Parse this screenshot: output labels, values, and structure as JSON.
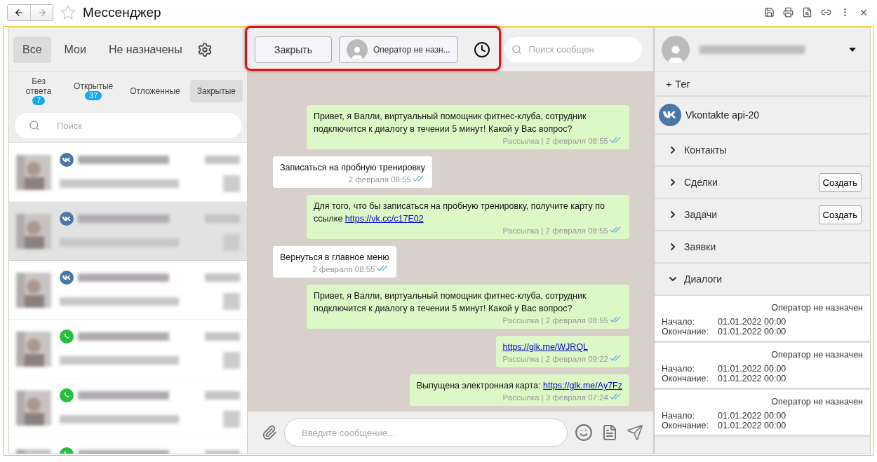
{
  "window": {
    "title": "Мессенджер",
    "starred": false
  },
  "top_tabs": [
    {
      "label": "Все",
      "selected": true
    },
    {
      "label": "Мои",
      "selected": false
    },
    {
      "label": "Не назначены",
      "selected": false
    }
  ],
  "filters": [
    {
      "label": "Без ответа",
      "badge": "7",
      "selected": false
    },
    {
      "label": "Открытые",
      "badge": "37",
      "selected": false
    },
    {
      "label": "Отложенные",
      "selected": false
    },
    {
      "label": "Закрытые",
      "selected": true
    }
  ],
  "contact_search": {
    "placeholder": "Поиск"
  },
  "contacts": [
    {
      "kind": "vk",
      "selected": false
    },
    {
      "kind": "vk",
      "selected": true
    },
    {
      "kind": "vk",
      "selected": false
    },
    {
      "kind": "whatsapp",
      "selected": false
    },
    {
      "kind": "whatsapp",
      "selected": false
    },
    {
      "kind": "whatsapp",
      "selected": false
    }
  ],
  "chat_header": {
    "close_button": "Закрыть",
    "operator_button": "Оператор не назн...",
    "search": {
      "placeholder": "Поиск сообщен"
    }
  },
  "messages": [
    {
      "kind": "out",
      "text": "Привет, я Валли, виртуальный помощник фитнес-клуба, сотрудник подключится к диалогу в течении 5 минут! Какой у Вас вопрос?",
      "meta": "Рассылка | 2 февраля 08:55",
      "read": true
    },
    {
      "kind": "in",
      "text": "Записаться на пробную тренировку",
      "meta": "2 февраля 08:55",
      "read": true
    },
    {
      "kind": "out",
      "text": "Для того, что бы записаться на пробную тренировку, получите карту по ссылке ",
      "link": "https://vk.cc/c17E02",
      "meta": "Рассылка | 2 февраля 08:55",
      "read": true
    },
    {
      "kind": "in",
      "text": "Вернуться в главное меню",
      "meta": "2 февраля 08:55",
      "read": true
    },
    {
      "kind": "out",
      "text": "Привет, я Валли, виртуальный помощник фитнес-клуба, сотрудник подключится к диалогу в течении 5 минут! Какой у Вас вопрос?",
      "meta": "Рассылка | 2 февраля 08:55",
      "read": true
    },
    {
      "kind": "out",
      "link": "https://glk.me/WJRQL",
      "meta": "Рассылка | 2 февраля 09:22",
      "read": true
    },
    {
      "kind": "out",
      "text": "Выпущена электронная карта: ",
      "link": "https://glk.me/Ay7Fz",
      "meta": "Рассылка | 3 февраля 07:24",
      "read": true
    }
  ],
  "composer": {
    "placeholder": "Введите сообщение..."
  },
  "details": {
    "tag_button": "+ Тег",
    "channel": "Vkontakte api-20",
    "sections": [
      {
        "label": "Контакты",
        "expanded": false
      },
      {
        "label": "Сделки",
        "expanded": false,
        "action": "Создать"
      },
      {
        "label": "Задачи",
        "expanded": false,
        "action": "Создать"
      },
      {
        "label": "Заявки",
        "expanded": false
      },
      {
        "label": "Диалоги",
        "expanded": true
      }
    ],
    "dialogs": [
      {
        "operator": "Оператор не назначен",
        "start_label": "Начало:",
        "start": "01.01.2022 00:00",
        "end_label": "Окончание:",
        "end": "01.01.2022 00:00"
      },
      {
        "operator": "Оператор не назначен",
        "start_label": "Начало:",
        "start": "01.01.2022 00:00",
        "end_label": "Окончание:",
        "end": "01.01.2022 00:00"
      },
      {
        "operator": "Оператор не назначен",
        "start_label": "Начало:",
        "start": "01.01.2022 00:00",
        "end_label": "Окончание:",
        "end": "01.01.2022 00:00"
      }
    ]
  }
}
